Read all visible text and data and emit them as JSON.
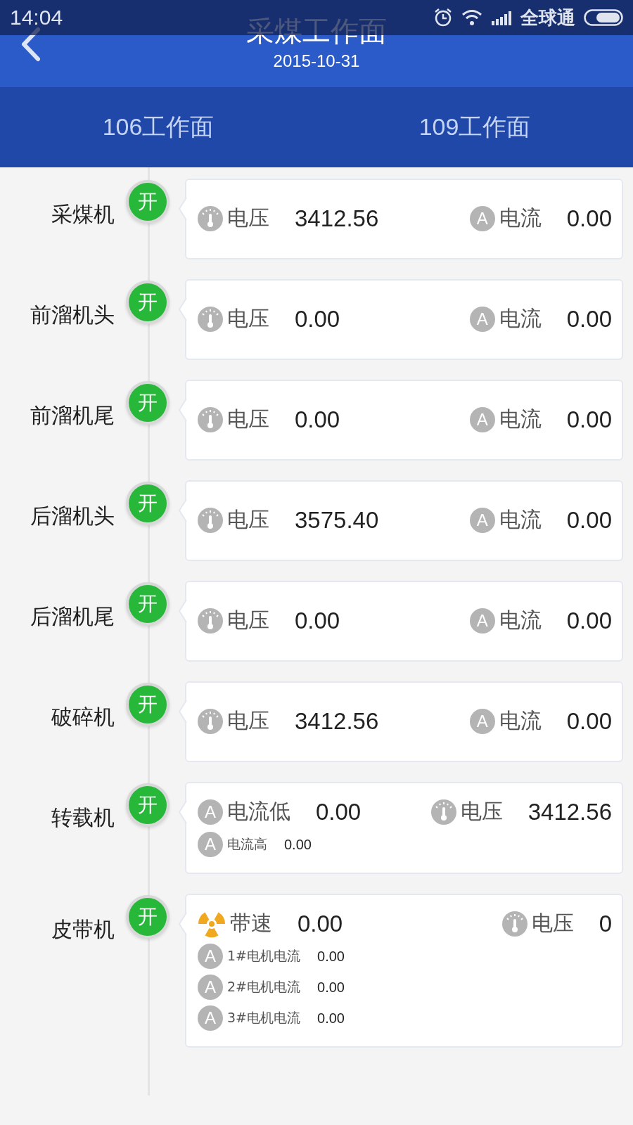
{
  "status_bar": {
    "time": "14:04",
    "carrier": "全球通"
  },
  "header": {
    "title": "采煤工作面",
    "date": "2015-10-31"
  },
  "tabs": [
    {
      "label": "106工作面",
      "selected": false
    },
    {
      "label": "109工作面",
      "selected": false
    }
  ],
  "machines": [
    {
      "name": "采煤机",
      "badge": "开",
      "on": true,
      "lines": [
        {
          "kind": "main",
          "items": [
            {
              "kind": "voltage",
              "label": "电压",
              "value": "3412.56"
            },
            {
              "kind": "current",
              "icon_letter": "A",
              "label": "电流",
              "value": "0.00"
            }
          ]
        }
      ]
    },
    {
      "name": "前溜机头",
      "badge": "开",
      "on": true,
      "lines": [
        {
          "kind": "main",
          "items": [
            {
              "kind": "voltage",
              "label": "电压",
              "value": "0.00"
            },
            {
              "kind": "current",
              "icon_letter": "A",
              "label": "电流",
              "value": "0.00"
            }
          ]
        }
      ]
    },
    {
      "name": "前溜机尾",
      "badge": "开",
      "on": true,
      "lines": [
        {
          "kind": "main",
          "items": [
            {
              "kind": "voltage",
              "label": "电压",
              "value": "0.00"
            },
            {
              "kind": "current",
              "icon_letter": "A",
              "label": "电流",
              "value": "0.00"
            }
          ]
        }
      ]
    },
    {
      "name": "后溜机头",
      "badge": "开",
      "on": true,
      "lines": [
        {
          "kind": "main",
          "items": [
            {
              "kind": "voltage",
              "label": "电压",
              "value": "3575.40"
            },
            {
              "kind": "current",
              "icon_letter": "A",
              "label": "电流",
              "value": "0.00"
            }
          ]
        }
      ]
    },
    {
      "name": "后溜机尾",
      "badge": "开",
      "on": true,
      "lines": [
        {
          "kind": "main",
          "items": [
            {
              "kind": "voltage",
              "label": "电压",
              "value": "0.00"
            },
            {
              "kind": "current",
              "icon_letter": "A",
              "label": "电流",
              "value": "0.00"
            }
          ]
        }
      ]
    },
    {
      "name": "破碎机",
      "badge": "开",
      "on": true,
      "lines": [
        {
          "kind": "main",
          "items": [
            {
              "kind": "voltage",
              "label": "电压",
              "value": "3412.56"
            },
            {
              "kind": "current",
              "icon_letter": "A",
              "label": "电流",
              "value": "0.00"
            }
          ]
        }
      ]
    },
    {
      "name": "转载机",
      "badge": "开",
      "on": true,
      "lines": [
        {
          "kind": "main",
          "items": [
            {
              "kind": "current",
              "icon_letter": "A",
              "label": "电流低",
              "value": "0.00"
            },
            {
              "kind": "voltage",
              "label": "电压",
              "value": "3412.56"
            }
          ]
        },
        {
          "kind": "sub",
          "items": [
            {
              "kind": "current",
              "icon_letter": "A",
              "label": "电流高",
              "value": "0.00"
            }
          ]
        }
      ]
    },
    {
      "name": "皮带机",
      "badge": "开",
      "on": true,
      "lines": [
        {
          "kind": "main",
          "items": [
            {
              "kind": "speed",
              "label": "带速",
              "value": "0.00"
            },
            {
              "kind": "voltage",
              "label": "电压",
              "value": "0"
            }
          ]
        },
        {
          "kind": "sub",
          "items": [
            {
              "kind": "current",
              "icon_letter": "A",
              "label": "1#电机电流",
              "value": "0.00"
            }
          ]
        },
        {
          "kind": "sub",
          "items": [
            {
              "kind": "current",
              "icon_letter": "A",
              "label": "2#电机电流",
              "value": "0.00"
            }
          ]
        },
        {
          "kind": "sub",
          "items": [
            {
              "kind": "current",
              "icon_letter": "A",
              "label": "3#电机电流",
              "value": "0.00"
            }
          ]
        }
      ]
    }
  ]
}
